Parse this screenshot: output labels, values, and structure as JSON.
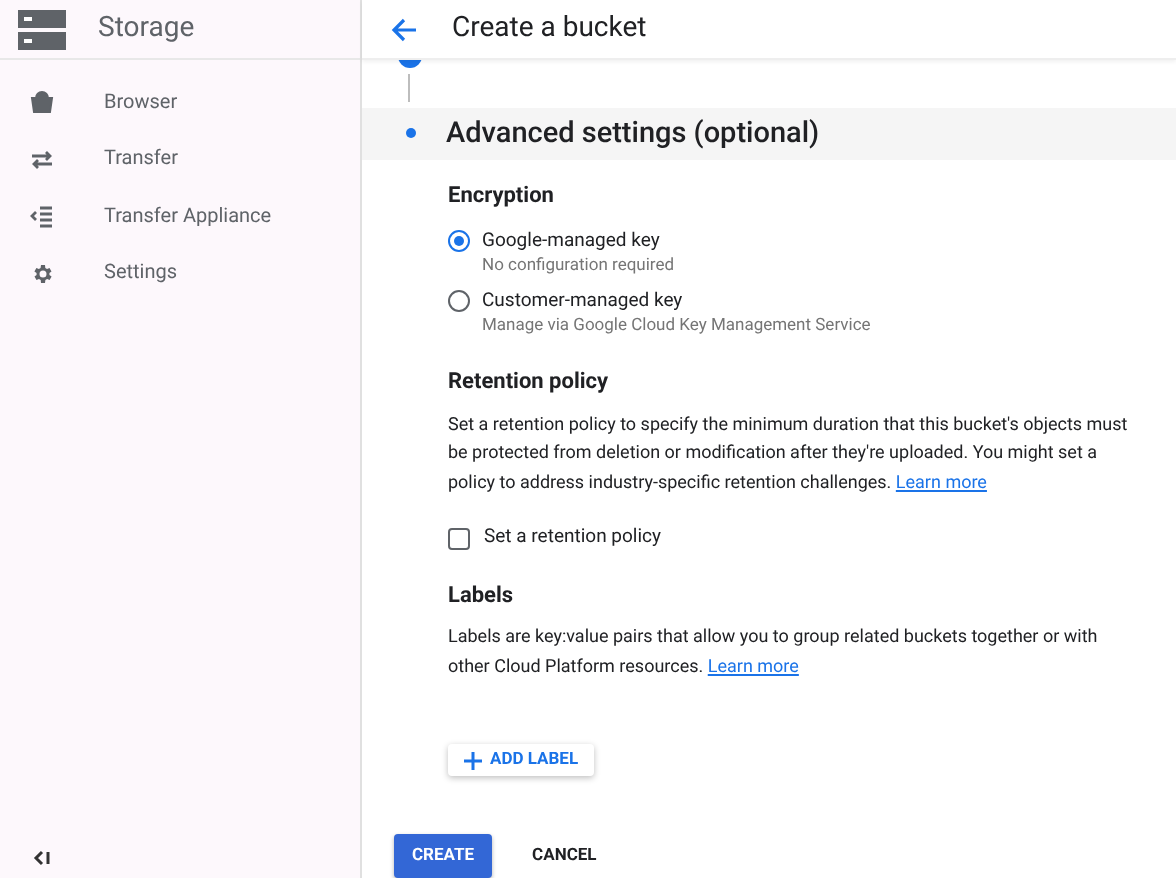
{
  "sidebar": {
    "title": "Storage",
    "items": [
      {
        "label": "Browser",
        "kind": "bag",
        "selected": false
      },
      {
        "label": "Transfer",
        "kind": "arrows",
        "selected": false
      },
      {
        "label": "Transfer Appliance",
        "kind": "list",
        "selected": false
      },
      {
        "label": "Settings",
        "kind": "gear",
        "selected": false
      }
    ]
  },
  "header": {
    "title": "Create a bucket"
  },
  "steps": [
    {
      "kind": "done"
    },
    {
      "title": "Advanced settings (optional)",
      "kind": "current"
    }
  ],
  "encryption": {
    "title": "Encryption",
    "options": [
      {
        "label": "Google-managed key",
        "description": "No configuration required",
        "selected": true
      },
      {
        "label": "Customer-managed key",
        "description": "Manage via Google Cloud Key Management Service",
        "selected": false
      }
    ]
  },
  "retention": {
    "title": "Retention policy",
    "text": "Set a retention policy to specify the minimum duration that this bucket's objects must be protected from deletion or modification after they're uploaded. You might set a policy to address industry-specific retention challenges.",
    "link": "Learn more",
    "checkbox": {
      "label": "Set a retention policy",
      "checked": false
    }
  },
  "labels": {
    "title": "Labels",
    "text": "Labels are key:value pairs that allow you to group related buckets together or with other Cloud Platform resources.",
    "link": "Learn more",
    "add_button": "ADD LABEL"
  },
  "buttons": {
    "create": "CREATE",
    "cancel": "CANCEL"
  }
}
